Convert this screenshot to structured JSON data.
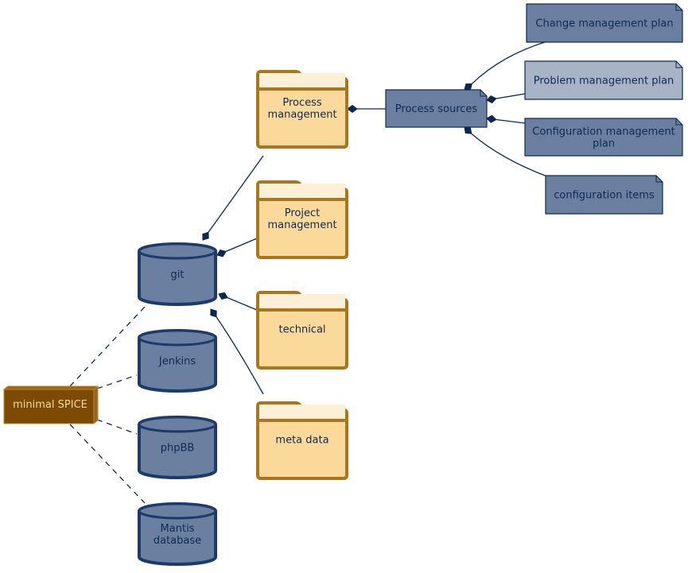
{
  "colors": {
    "edge": "#0b2752",
    "db_fill": "#6b7fa0",
    "db_stroke": "#1c3a6a",
    "folder_fill": "#fbd99b",
    "folder_tab": "#fef0d6",
    "folder_stroke": "#a8761e",
    "note_fill": "#6b7fa0",
    "note_fill_light": "#a8b3c6",
    "note_stroke": "#0e2a54",
    "node_fill": "#7c4a00",
    "node_top": "#9a6316",
    "node_stroke": "#b58a3a",
    "node_text": "#f5d9a0"
  },
  "nodes": {
    "root": {
      "label": "minimal SPICE"
    },
    "databases": [
      {
        "id": "git",
        "lines": [
          "git"
        ]
      },
      {
        "id": "jenkins",
        "lines": [
          "Jenkins"
        ]
      },
      {
        "id": "phpbb",
        "lines": [
          "phpBB"
        ]
      },
      {
        "id": "mantis",
        "lines": [
          "Mantis",
          "database"
        ]
      }
    ],
    "folders": [
      {
        "id": "process",
        "lines": [
          "Process",
          "management"
        ]
      },
      {
        "id": "project",
        "lines": [
          "Project",
          "management"
        ]
      },
      {
        "id": "technical",
        "lines": [
          "technical"
        ]
      },
      {
        "id": "meta",
        "lines": [
          "meta data"
        ]
      }
    ],
    "process_sources": {
      "label": "Process sources"
    },
    "artifacts": [
      {
        "id": "change",
        "lines": [
          "Change management plan"
        ],
        "highlight": false
      },
      {
        "id": "problem",
        "lines": [
          "Problem management plan"
        ],
        "highlight": true
      },
      {
        "id": "config",
        "lines": [
          "Configuration management",
          "plan"
        ],
        "highlight": false
      },
      {
        "id": "items",
        "lines": [
          "configuration items"
        ],
        "highlight": false
      }
    ]
  },
  "edges": [
    {
      "from": "minimal SPICE",
      "to": "git",
      "style": "dashed"
    },
    {
      "from": "minimal SPICE",
      "to": "Jenkins",
      "style": "dashed"
    },
    {
      "from": "minimal SPICE",
      "to": "phpBB",
      "style": "dashed"
    },
    {
      "from": "minimal SPICE",
      "to": "Mantis database",
      "style": "dashed"
    },
    {
      "from": "git",
      "to": "Process management",
      "style": "composition"
    },
    {
      "from": "git",
      "to": "Project management",
      "style": "composition"
    },
    {
      "from": "git",
      "to": "technical",
      "style": "composition"
    },
    {
      "from": "git",
      "to": "meta data",
      "style": "composition"
    },
    {
      "from": "Process management",
      "to": "Process sources",
      "style": "composition"
    },
    {
      "from": "Process sources",
      "to": "Change management plan",
      "style": "composition"
    },
    {
      "from": "Process sources",
      "to": "Problem management plan",
      "style": "composition"
    },
    {
      "from": "Process sources",
      "to": "Configuration management plan",
      "style": "composition"
    },
    {
      "from": "Process sources",
      "to": "configuration items",
      "style": "composition"
    }
  ]
}
